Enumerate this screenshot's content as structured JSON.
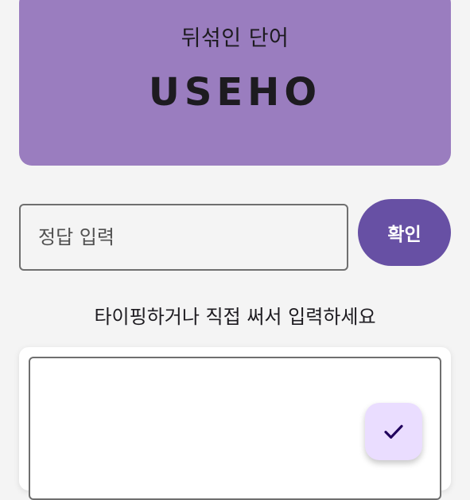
{
  "word_card": {
    "title": "뒤섞인 단어",
    "scrambled_word": "USEHO"
  },
  "answer": {
    "placeholder": "정답 입력",
    "value": "",
    "confirm_label": "확인"
  },
  "instruction": "타이핑하거나 직접 써서 입력하세요",
  "drawing_pad": {
    "submit_icon": "check-icon"
  },
  "colors": {
    "background": "#f4f4f4",
    "card": "#9a7dbf",
    "primary": "#6750a4",
    "fab": "#eaddff",
    "on_fab": "#21005d"
  }
}
